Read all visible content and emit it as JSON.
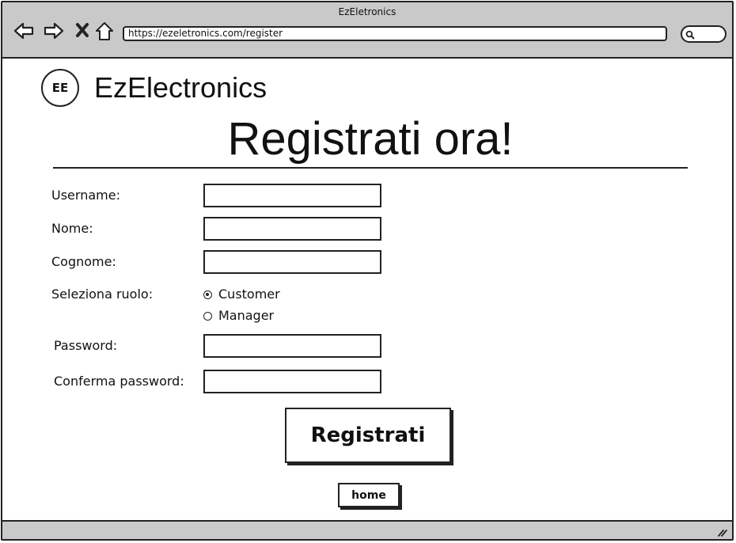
{
  "window": {
    "title": "EzEletronics",
    "url": "https://ezeletronics.com/register"
  },
  "header": {
    "logo_text": "EE",
    "brand_name": "EzElectronics"
  },
  "form": {
    "title": "Registrati ora!",
    "username_label": "Username:",
    "nome_label": "Nome:",
    "cognome_label": "Cognome:",
    "role_label": "Seleziona ruolo:",
    "roles": [
      {
        "label": "Customer",
        "selected": true
      },
      {
        "label": "Manager",
        "selected": false
      }
    ],
    "password_label": "Password:",
    "confirm_password_label": "Conferma password:",
    "submit_label": "Registrati",
    "home_label": "home"
  },
  "icons": {
    "back": "arrow-left-icon",
    "forward": "arrow-right-icon",
    "stop": "close-icon",
    "home": "home-icon",
    "search": "search-icon",
    "resize": "resize-grip-icon"
  },
  "colors": {
    "chrome": "#c9c9c9",
    "stroke": "#222222",
    "background": "#ffffff"
  }
}
